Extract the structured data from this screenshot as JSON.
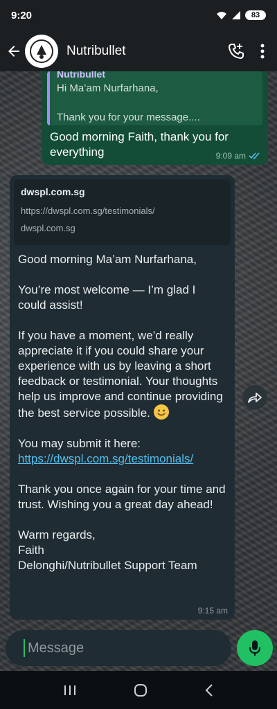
{
  "status": {
    "time": "9:20",
    "battery": "83"
  },
  "header": {
    "title": "Nutribullet"
  },
  "outgoing": {
    "quote_author": "Nutribullet",
    "quote_text": "Hi Ma’am Nurfarhana,\n\nThank you for your message....",
    "text": "Good morning Faith, thank you for everything",
    "time": "9:09 am"
  },
  "incoming": {
    "preview_title": "dwspl.com.sg",
    "preview_url": "https://dwspl.com.sg/testimonials/",
    "preview_domain": "dwspl.com.sg",
    "p1": "Good morning Ma’am Nurfarhana,",
    "p2": "You’re most welcome — I’m glad I could assist!",
    "p3": "If you have a moment, we’d really appreciate it if you could share your experience with us by leaving a short feedback or testimonial. Your thoughts help us improve and continue providing the best service possible.",
    "p4_label": "You may submit it here:",
    "p4_link": "https://dwspl.com.sg/testimonials/",
    "p5": "Thank you once again for your time and trust. Wishing you a great day ahead!",
    "p6_line1": "Warm regards,",
    "p6_line2": "Faith",
    "p6_line3": "Delonghi/Nutribullet Support Team",
    "time": "9:15 am"
  },
  "input": {
    "placeholder": "Message"
  },
  "colors": {
    "accent": "#21c063",
    "link": "#53bdeb",
    "outgoing_bubble": "#144d37",
    "incoming_bubble": "#202c33"
  }
}
